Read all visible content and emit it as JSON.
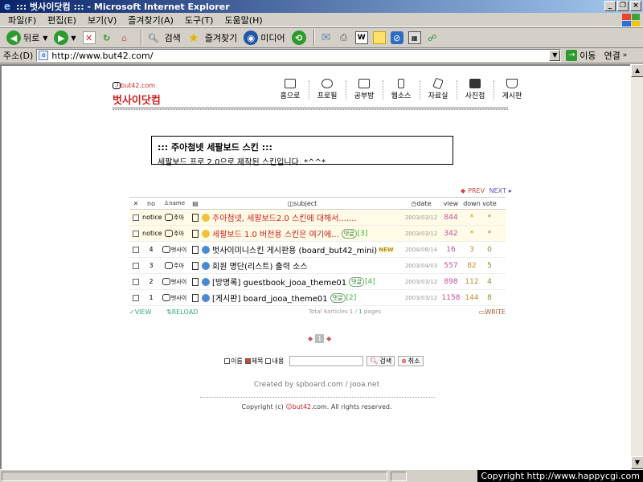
{
  "window": {
    "title": "::: 벗사이닷컴 ::: - Microsoft Internet Explorer"
  },
  "menu": [
    "파일(F)",
    "편집(E)",
    "보기(V)",
    "즐겨찾기(A)",
    "도구(T)",
    "도움말(H)"
  ],
  "toolbar": {
    "back": "뒤로",
    "search": "검색",
    "favorites": "즐겨찾기",
    "media": "미디어"
  },
  "address": {
    "label": "주소(D)",
    "url": "http://www.but42.com/",
    "go": "이동",
    "links": "연결"
  },
  "site": {
    "logo_small": "but42.com",
    "logo_text": "벗사이닷컴",
    "nav": [
      "홈으로",
      "프로필",
      "공부방",
      "웹소스",
      "자료실",
      "사진첩",
      "게시판"
    ]
  },
  "skin_box": {
    "title": "::: 주아첨넷 세팔보드 스킨 :::",
    "desc": "세팔보드 프로 2.0으로 제작된 스킨입니다. *^^*"
  },
  "prevnext": {
    "prev": "PREV",
    "next": "NEXT"
  },
  "board": {
    "headers": {
      "no": "no",
      "name": "name",
      "subject": "subject",
      "date": "date",
      "view": "view",
      "down": "down",
      "vote": "vote"
    },
    "rows": [
      {
        "no": "notice",
        "name": "주아",
        "subject": "주아첨넷, 세팔보드2.0 스킨에 대해서.......",
        "date": "2003/03/12",
        "view": "844",
        "down": "*",
        "vote": "*",
        "comments": "",
        "is_new": ""
      },
      {
        "no": "notice",
        "name": "주아",
        "subject": "세팔보드 1.0 버전용 스킨은 여기에...",
        "date": "2003/03/12",
        "view": "342",
        "down": "*",
        "vote": "*",
        "comments": "[3]",
        "is_new": ""
      },
      {
        "no": "4",
        "name": "벗사이",
        "subject": "벗사이미니스킨 게시판용 (board_but42_mini)",
        "date": "2004/08/14",
        "view": "16",
        "down": "3",
        "vote": "0",
        "comments": "",
        "is_new": "NEW"
      },
      {
        "no": "3",
        "name": "주아",
        "subject": "회원 명단(리스트) 출력 소스",
        "date": "2003/04/03",
        "view": "557",
        "down": "82",
        "vote": "5",
        "comments": "",
        "is_new": ""
      },
      {
        "no": "2",
        "name": "벗사이",
        "subject": "[방명록] guestbook_jooa_theme01",
        "date": "2003/03/12",
        "view": "898",
        "down": "112",
        "vote": "4",
        "comments": "[4]",
        "is_new": ""
      },
      {
        "no": "1",
        "name": "벗사이",
        "subject": "[게시판] board_jooa_theme01",
        "date": "2003/03/12",
        "view": "1158",
        "down": "144",
        "vote": "8",
        "comments": "[2]",
        "is_new": ""
      }
    ],
    "comment_tag": "댓글",
    "footer": {
      "view": "VIEW",
      "reload": "RELOAD",
      "total": "Total",
      "articles": "4",
      "articles_word": "articles",
      "page_cur": "1",
      "page_total": "1",
      "pages_word": "pages",
      "write": "WRITE"
    }
  },
  "pager": {
    "current": "1"
  },
  "search": {
    "opt_name": "이름",
    "opt_subject": "제목",
    "opt_content": "내용",
    "search_btn": "검색",
    "cancel_btn": "취소"
  },
  "credit": "Created by spboard.com / jooa.net",
  "copyright": {
    "prefix": "Copyright (c)",
    "brand": "but42",
    "suffix": ".com. All rights reserved."
  },
  "status": {
    "right": "Copyright  http://www.happycgi.com"
  },
  "colors": {
    "title_bar": "#0a246a",
    "notice_bg": "#fffbe6",
    "notice_text": "#d02020",
    "view_count": "#c24b9e"
  }
}
